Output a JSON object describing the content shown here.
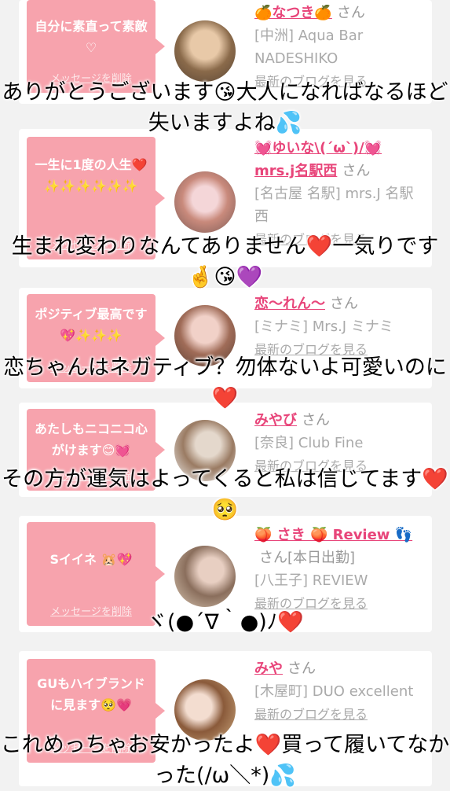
{
  "entries": [
    {
      "message": "自分に素直って素敵♡",
      "delete_label": "メッセージを削除",
      "name": "🍊なつき🍊",
      "name_suffix": "さん",
      "shop": "[中洲] Aqua Bar NADESHIKO",
      "blog_label": "最新のブログを見る",
      "overlay": "ありがとうございます😘大人になればなるほど失いますよね💦"
    },
    {
      "message": "一生に1度の人生❤️✨✨✨✨✨✨",
      "delete_label": "メッセージを削除",
      "name": "💓ゆいな\\(´ω`)/💓 mrs.j名駅西",
      "name_suffix": "さん",
      "shop": "[名古屋 名駅] mrs.J 名駅西",
      "blog_label": "最新のブログを見る",
      "overlay": "生まれ変わりなんてありません❤️一気りです🤞😘💜"
    },
    {
      "message": "ポジティブ最高です💖✨✨✨",
      "delete_label": "メッセージを削除",
      "name": "恋〜れん〜",
      "name_suffix": "さん",
      "shop": "[ミナミ] Mrs.J ミナミ",
      "blog_label": "最新のブログを見る",
      "overlay": "恋ちゃんはネガティブ？勿体ないよ可愛いのに❤️"
    },
    {
      "message": "あたしもニコニコ心がけます😊💓",
      "delete_label": "メッセージを削除",
      "name": "みやび",
      "name_suffix": "さん",
      "shop": "[奈良] Club Fine",
      "blog_label": "最新のブログを見る",
      "overlay": "その方が運気はよってくると私は信じてます❤️🥺"
    },
    {
      "message": "Sイイネ 🐹💖",
      "delete_label": "メッセージを削除",
      "name": "🍑 さき 🍑 Review 👣",
      "name_suffix": "さん[本日出勤]",
      "shop": "[八王子] REVIEW",
      "blog_label": "最新のブログを見る",
      "overlay": "ヾ(●´∇｀●)ﾉ❤️"
    },
    {
      "message": "GUもハイブランドに見ます🥺💗",
      "delete_label": "メッセージを削除",
      "name": "みや",
      "name_suffix": "さん",
      "shop": "[木屋町] DUO excellent",
      "blog_label": "最新のブログを見る",
      "overlay": "これめっちゃお安かったよ❤️買って履いてなかった(/ω＼*)💦"
    }
  ],
  "colors": {
    "page_bg": "#f2f2f2",
    "card_bg": "#ffffff",
    "bubble_pink": "#f7a3ad",
    "name_pink": "#e8457a",
    "muted_gray": "#aaaaaa"
  }
}
